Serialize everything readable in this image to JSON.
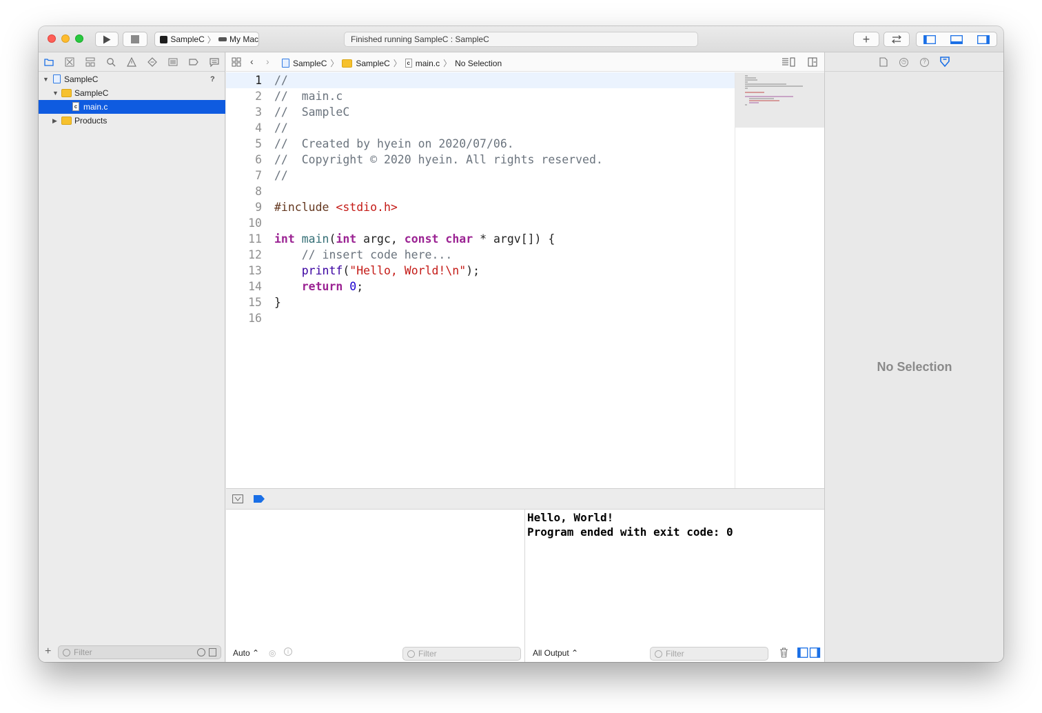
{
  "toolbar": {
    "scheme_name": "SampleC",
    "destination": "My Mac",
    "status": "Finished running SampleC : SampleC"
  },
  "navigator": {
    "tree": [
      {
        "label": "SampleC",
        "kind": "project",
        "badge": "?"
      },
      {
        "label": "SampleC",
        "kind": "folder"
      },
      {
        "label": "main.c",
        "kind": "file",
        "selected": true
      },
      {
        "label": "Products",
        "kind": "folder"
      }
    ],
    "filter_placeholder": "Filter"
  },
  "editor": {
    "breadcrumbs": [
      "SampleC",
      "SampleC",
      "main.c",
      "No Selection"
    ],
    "current_line": 1,
    "line_numbers": [
      "1",
      "2",
      "3",
      "4",
      "5",
      "6",
      "7",
      "8",
      "9",
      "10",
      "11",
      "12",
      "13",
      "14",
      "15",
      "16"
    ],
    "lines": [
      "//",
      "//  main.c",
      "//  SampleC",
      "//",
      "//  Created by hyein on 2020/07/06.",
      "//  Copyright © 2020 hyein. All rights reserved.",
      "//",
      "",
      "#include <stdio.h>",
      "",
      "int main(int argc, const char * argv[]) {",
      "    // insert code here...",
      "    printf(\"Hello, World!\\n\");",
      "    return 0;",
      "}",
      ""
    ]
  },
  "debug": {
    "variables_mode": "Auto",
    "variables_filter_placeholder": "Filter",
    "console_lines": [
      "Hello, World!",
      "Program ended with exit code: 0"
    ],
    "output_mode": "All Output",
    "console_filter_placeholder": "Filter"
  },
  "inspector": {
    "empty_label": "No Selection"
  },
  "colors": {
    "selection": "#0f5be0",
    "keyword": "#9b2393",
    "string": "#c41a16",
    "comment": "#6a737d",
    "number": "#1c00cf"
  }
}
